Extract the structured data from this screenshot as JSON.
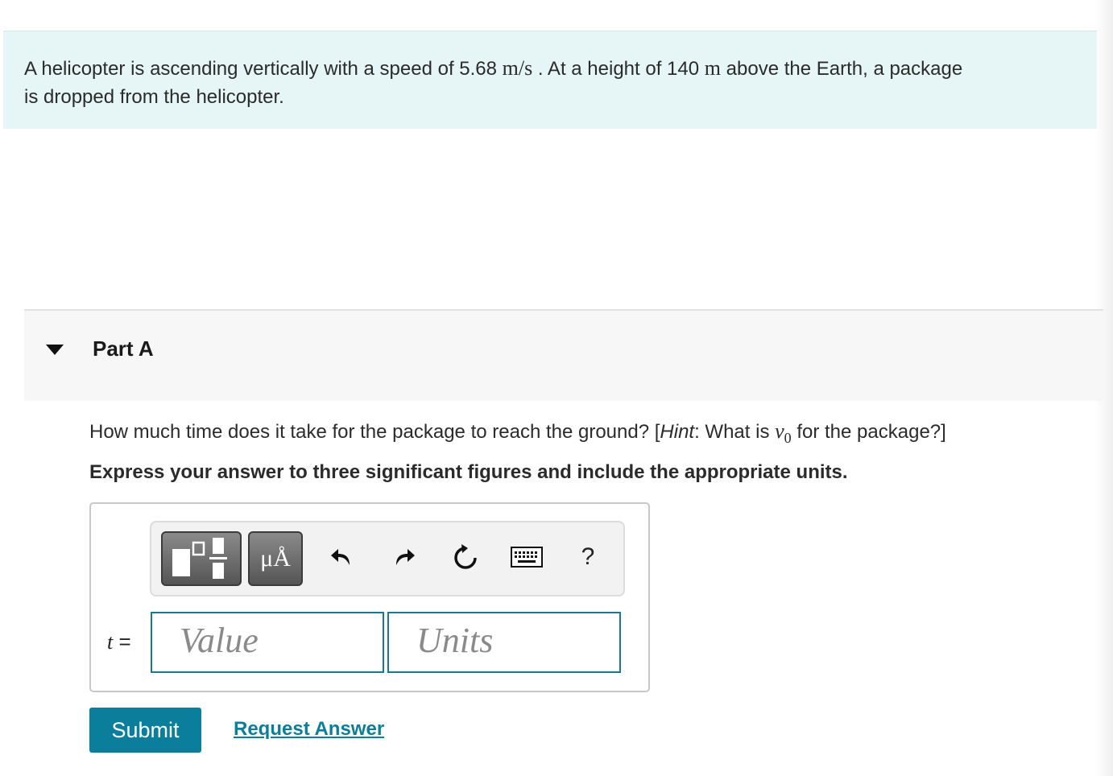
{
  "problem": {
    "pre": "A helicopter is ascending vertically with a speed of 5.68 ",
    "speed_unit": "m/s",
    "mid": " . At a height of 140 ",
    "height_unit": "m",
    "post1": " above the Earth, a package",
    "post2": "is dropped from the helicopter."
  },
  "part": {
    "title": "Part A"
  },
  "question": {
    "pre": "How much time does it take for the package to reach the ground? [",
    "hint_word": "Hint",
    "mid": ": What is ",
    "v0": "v",
    "v0_sub": "0",
    "post": " for the package?]"
  },
  "instruction": "Express your answer to three significant figures and include the appropriate units.",
  "toolbar": {
    "units_label": "μÅ",
    "help_label": "?"
  },
  "answer": {
    "var": "t",
    "equals": " =",
    "value_placeholder": "Value",
    "units_placeholder": "Units"
  },
  "actions": {
    "submit": "Submit",
    "request": "Request Answer"
  },
  "colors": {
    "accent": "#0a7e9b",
    "intro_bg": "#e6f5f5"
  }
}
